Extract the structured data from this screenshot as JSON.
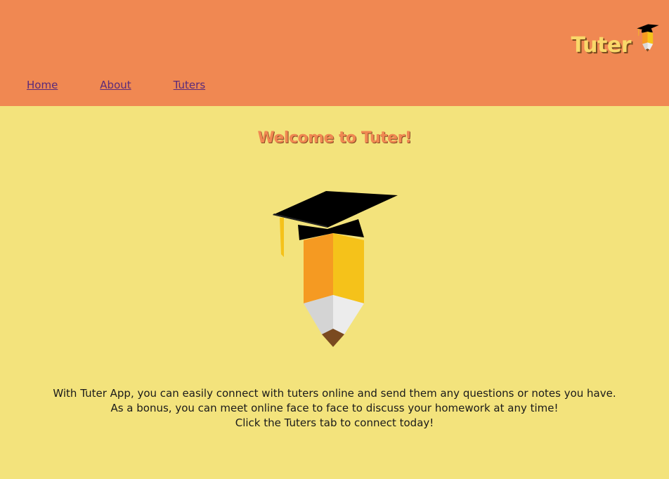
{
  "header": {
    "brand_title": "Tuter",
    "logo_icon": "graduation-pencil-icon",
    "background_color": "#f08852"
  },
  "nav": {
    "items": [
      {
        "label": "Home"
      },
      {
        "label": "About"
      },
      {
        "label": "Tuters"
      }
    ]
  },
  "main": {
    "welcome_title": "Welcome to Tuter!",
    "hero_icon": "graduation-pencil-icon",
    "description_lines": [
      "With Tuter App, you can easily connect with tuters online and send them any questions or notes you have.",
      "As a bonus, you can meet online face to face to discuss your homework at any time!",
      "Click the Tuters tab to connect today!"
    ],
    "background_color": "#f3e37c"
  }
}
